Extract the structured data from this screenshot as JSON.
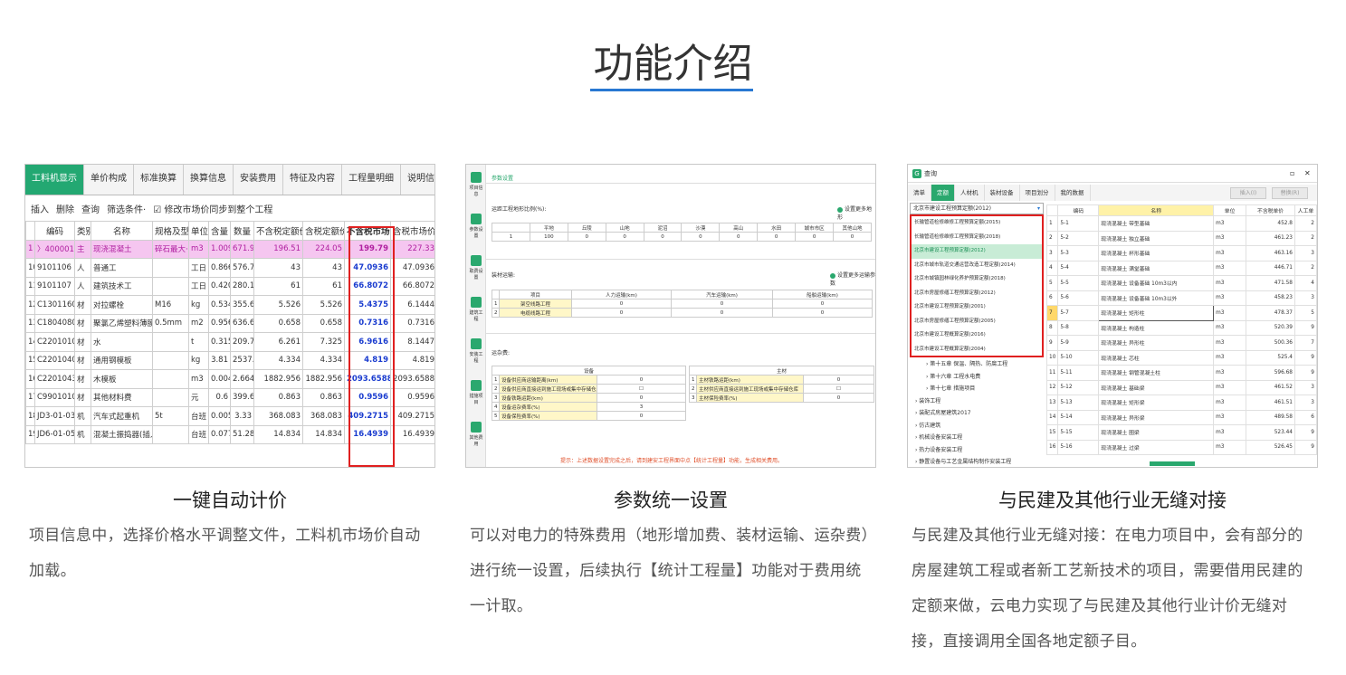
{
  "page": {
    "title": "功能介绍"
  },
  "cards": [
    {
      "caption": "一键自动计价",
      "desc": "项目信息中，选择价格水平调整文件，工料机市场价自动加载。"
    },
    {
      "caption": "参数统一设置",
      "desc": "可以对电力的特殊费用（地形增加费、装材运输、运杂费）进行统一设置，后续执行【统计工程量】功能对于费用统一计取。"
    },
    {
      "caption": "与民建及其他行业无缝对接",
      "desc": "与民建及其他行业无缝对接：在电力项目中，会有部分的房屋建筑工程或者新工艺新技术的项目，需要借用民建的定额来做，云电力实现了与民建及其他行业计价无缝对接，直接调用全国各地定额子目。"
    }
  ],
  "shot1": {
    "tabs": [
      "工料机显示",
      "单价构成",
      "标准换算",
      "换算信息",
      "安装费用",
      "特征及内容",
      "工程量明细",
      "说明信息"
    ],
    "toolbar": [
      "插入",
      "删除",
      "查询",
      "筛选条件·",
      "☑ 修改市场价同步到整个工程"
    ],
    "headers": [
      "",
      "编码",
      "类别",
      "名称",
      "规格及型号",
      "单位",
      "含量",
      "数量",
      "不含税定额价",
      "含税定额价",
      "不含税市场价",
      "含税市场价"
    ],
    "rows": [
      [
        "1",
        "〉400001901",
        "主",
        "现浇混凝土",
        "碎石最大···",
        "m3",
        "1.009",
        "671.994",
        "196.51",
        "224.05",
        "199.79",
        "227.33"
      ],
      [
        "10",
        "9101106",
        "人",
        "普通工",
        "",
        "工日",
        "0.866",
        "576.756",
        "43",
        "43",
        "47.0936",
        "47.0936"
      ],
      [
        "11",
        "9101107",
        "人",
        "建筑技术工",
        "",
        "工日",
        "0.4206",
        "280.1···",
        "61",
        "61",
        "66.8072",
        "66.8072"
      ],
      [
        "12",
        "C13011603@2",
        "材",
        "对拉螺栓",
        "M16",
        "kg",
        "0.534",
        "355.644",
        "5.526",
        "5.526",
        "5.4375",
        "6.1444"
      ],
      [
        "13",
        "C18040802@1",
        "材",
        "聚氯乙烯塑料薄膜",
        "0.5mm",
        "m2",
        "0.956",
        "636.696",
        "0.658",
        "0.658",
        "0.7316",
        "0.7316"
      ],
      [
        "14",
        "C22010101@1",
        "材",
        "水",
        "",
        "t",
        "0.315",
        "209.79",
        "6.261",
        "7.325",
        "6.9616",
        "8.1447"
      ],
      [
        "15",
        "C22010401@1",
        "材",
        "通用钢模板",
        "",
        "kg",
        "3.81",
        "2537.46",
        "4.334",
        "4.334",
        "4.819",
        "4.819"
      ],
      [
        "16",
        "C22010432@1",
        "材",
        "木模板",
        "",
        "m3",
        "0.004",
        "2.664",
        "1882.956",
        "1882.956",
        "2093.6588",
        "2093.6588"
      ],
      [
        "17",
        "C99010102@1",
        "材",
        "其他材料费",
        "",
        "元",
        "0.6",
        "399.6",
        "0.863",
        "0.863",
        "0.9596",
        "0.9596"
      ],
      [
        "18",
        "JD3-01-0339@1",
        "机",
        "汽车式起重机",
        "5t",
        "台班",
        "0.005",
        "3.33",
        "368.083",
        "368.083",
        "409.2715",
        "409.2715"
      ],
      [
        "19",
        "JD6-01-0520@1",
        "机",
        "混凝土振捣器(插入式)",
        "",
        "台班",
        "0.077",
        "51.282",
        "14.834",
        "14.834",
        "16.4939",
        "16.4939"
      ]
    ]
  },
  "shot2": {
    "top_tab": "参数设置",
    "side_items": [
      "项目信息",
      "参数设置",
      "取费设置",
      "建筑工程",
      "安装工程",
      "措施项目",
      "其他费用"
    ],
    "sec1": "运距工程地形比例(%):",
    "sec1_link": "设置更多地形",
    "sec1_headers": [
      "",
      "平地",
      "丘陵",
      "山地",
      "泥沼",
      "沙漠",
      "高山",
      "水田",
      "城市市区",
      "其他山地"
    ],
    "sec1_row": [
      "1",
      "100",
      "0",
      "0",
      "0",
      "0",
      "0",
      "0",
      "0",
      "0"
    ],
    "sec2": "装材运输:",
    "sec2_link": "设置更多运输参数",
    "sec2_headers": [
      "",
      "项目",
      "人力运输(km)",
      "汽车运输(km)",
      "船舶运输(km)"
    ],
    "sec2_rows": [
      [
        "1",
        "架空线路工程",
        "0",
        "0",
        "0"
      ],
      [
        "2",
        "电缆线路工程",
        "0",
        "0",
        "0"
      ]
    ],
    "sec3": "运杂费:",
    "sec3_left_head": "设备",
    "sec3_right_head": "主材",
    "sec3_left_rows": [
      [
        "1",
        "设备供应商运输距离(km)",
        "0"
      ],
      [
        "2",
        "设备供应商直接运到施工现场或集中存储仓库",
        "☐"
      ],
      [
        "3",
        "设备铁路运距(km)",
        "0"
      ],
      [
        "4",
        "设备运杂费率(%)",
        "3"
      ],
      [
        "5",
        "设备保险费率(%)",
        "0"
      ]
    ],
    "sec3_right_rows": [
      [
        "1",
        "主材铁路运距(km)",
        "0"
      ],
      [
        "2",
        "主材供应商直接运到施工现场或集中存储仓库",
        "☐"
      ],
      [
        "3",
        "主材保险费率(%)",
        "0"
      ]
    ],
    "notice": "提示：上述数据设置完成之后，请到建安工程界面中点【统计工程量】功能，生成相关费用。"
  },
  "shot3": {
    "window_title": "查询",
    "tabs": [
      "清单",
      "定额",
      "人材机",
      "装材设备",
      "项目划分",
      "我的数据"
    ],
    "btn_insert": "插入(I)",
    "btn_replace": "替换(R)",
    "dropdown_value": "北京市建设工程预算定额(2012)",
    "dropdown_items": [
      "长输管道检修维修工程预算定额(2015)",
      "长输管道检修维修工程预算定额(2018)",
      "北京市建设工程预算定额(2012)",
      "北京市城市轨道交通运营改造工程定额(2014)",
      "北京市城镇园林绿化养护预算定额(2018)",
      "北京市房屋修缮工程预算定额(2012)",
      "北京市建设工程预算定额(2001)",
      "北京市房屋修缮工程预算定额(2005)",
      "北京市建设工程概算定额(2016)",
      "北京市建设工程概算定额(2004)"
    ],
    "tree_items": [
      "›  第十五章 保温、隔热、防腐工程",
      "›  第十六章 工程水电费",
      "›  第十七章 措施项目",
      "›  装饰工程",
      "›  装配式房屋建筑2017",
      "›  仿古建筑",
      "›  机械设备安装工程",
      "›  热力设备安装工程",
      "›  静置设备与工艺金属结构制作安装工程"
    ],
    "headers": [
      "",
      "编码",
      "名称",
      "单位",
      "不含税单价",
      "人工单"
    ],
    "rows": [
      [
        "1",
        "5-1",
        "现浇混凝土 带型基础",
        "m3",
        "452.8",
        "2"
      ],
      [
        "2",
        "5-2",
        "现浇混凝土 独立基础",
        "m3",
        "461.23",
        "2"
      ],
      [
        "3",
        "5-3",
        "现浇混凝土 杯形基础",
        "m3",
        "463.16",
        "3"
      ],
      [
        "4",
        "5-4",
        "现浇混凝土 满堂基础",
        "m3",
        "446.71",
        "2"
      ],
      [
        "5",
        "5-5",
        "现浇混凝土 设备基础 10m3以内",
        "m3",
        "471.58",
        "4"
      ],
      [
        "6",
        "5-6",
        "现浇混凝土 设备基础 10m3以外",
        "m3",
        "458.23",
        "3"
      ],
      [
        "7",
        "5-7",
        "现浇混凝土 矩形柱",
        "m3",
        "478.37",
        "5"
      ],
      [
        "8",
        "5-8",
        "现浇混凝土 构造柱",
        "m3",
        "520.39",
        "9"
      ],
      [
        "9",
        "5-9",
        "现浇混凝土 异形柱",
        "m3",
        "500.36",
        "7"
      ],
      [
        "10",
        "5-10",
        "现浇混凝土 芯柱",
        "m3",
        "525.4",
        "9"
      ],
      [
        "11",
        "5-11",
        "现浇混凝土 钢管混凝土柱",
        "m3",
        "596.68",
        "9"
      ],
      [
        "12",
        "5-12",
        "现浇混凝土 基础梁",
        "m3",
        "461.52",
        "3"
      ],
      [
        "13",
        "5-13",
        "现浇混凝土 矩形梁",
        "m3",
        "461.51",
        "3"
      ],
      [
        "14",
        "5-14",
        "现浇混凝土 异形梁",
        "m3",
        "489.58",
        "6"
      ],
      [
        "15",
        "5-15",
        "现浇混凝土 圈梁",
        "m3",
        "523.44",
        "9"
      ],
      [
        "16",
        "5-16",
        "现浇混凝土 过梁",
        "m3",
        "526.45",
        "9"
      ]
    ]
  },
  "colors": {
    "accent_blue": "#2878d2",
    "green": "#2aa86e",
    "red_box": "#e02020"
  }
}
